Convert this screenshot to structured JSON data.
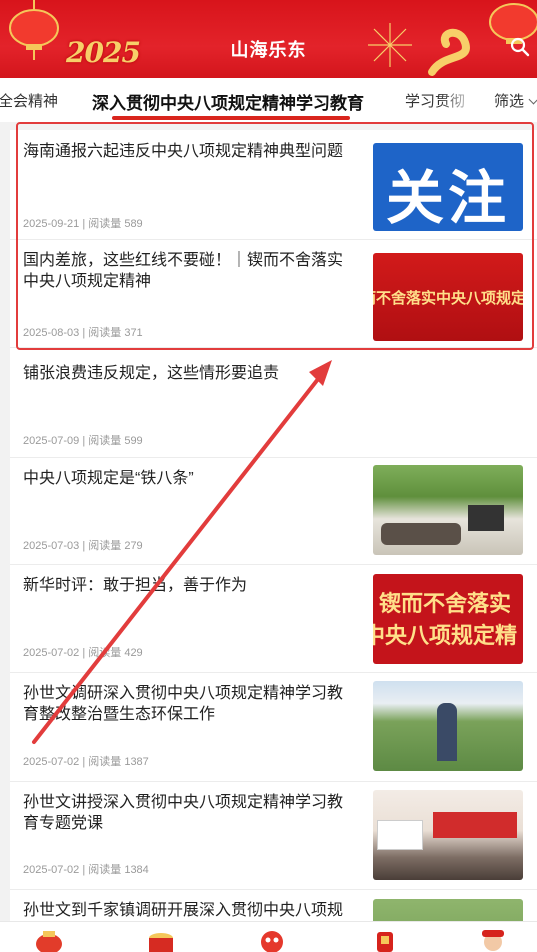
{
  "header": {
    "title": "山海乐东",
    "year_text": "2025"
  },
  "tabs": [
    {
      "label": "全会精神"
    },
    {
      "label": "深入贯彻中央八项规定精神学习教育"
    },
    {
      "label": "学习贯彻"
    }
  ],
  "filter": {
    "label": "筛选"
  },
  "articles": [
    {
      "title": "海南通报六起违反中央八项规定精神典型问题",
      "date": "2025-09-21",
      "views": "阅读量 589",
      "thumb_text": "关注"
    },
    {
      "title": "国内差旅，这些红线不要碰！｜锲而不舍落实中央八项规定精神",
      "date": "2025-08-03",
      "views": "阅读量 371",
      "thumb_text": "而不舍落实中央八项规定"
    },
    {
      "title": "铺张浪费违反规定，这些情形要追责",
      "date": "2025-07-09",
      "views": "阅读量 599"
    },
    {
      "title": "中央八项规定是“铁八条”",
      "date": "2025-07-03",
      "views": "阅读量 279"
    },
    {
      "title": "新华时评：敢于担当，善于作为",
      "date": "2025-07-02",
      "views": "阅读量 429",
      "thumb_text_1": "锲而不舍落实",
      "thumb_text_2": "中央八项规定精"
    },
    {
      "title": "孙世文调研深入贯彻中央八项规定精神学习教育整改整治暨生态环保工作",
      "date": "2025-07-02",
      "views": "阅读量 1387"
    },
    {
      "title": "孙世文讲授深入贯彻中央八项规定精神学习教育专题党课",
      "date": "2025-07-02",
      "views": "阅读量 1384"
    },
    {
      "title": "孙世文到千家镇调研开展深入贯彻中央八项规"
    }
  ],
  "colors": {
    "brand_red": "#d9251d",
    "highlight_red": "#e23c3c",
    "blue_banner": "#1e64c8"
  },
  "bottom_nav": [
    "lucky-bag-icon",
    "drum-icon",
    "lion-dance-icon",
    "fu-lantern-icon",
    "god-of-wealth-icon"
  ]
}
